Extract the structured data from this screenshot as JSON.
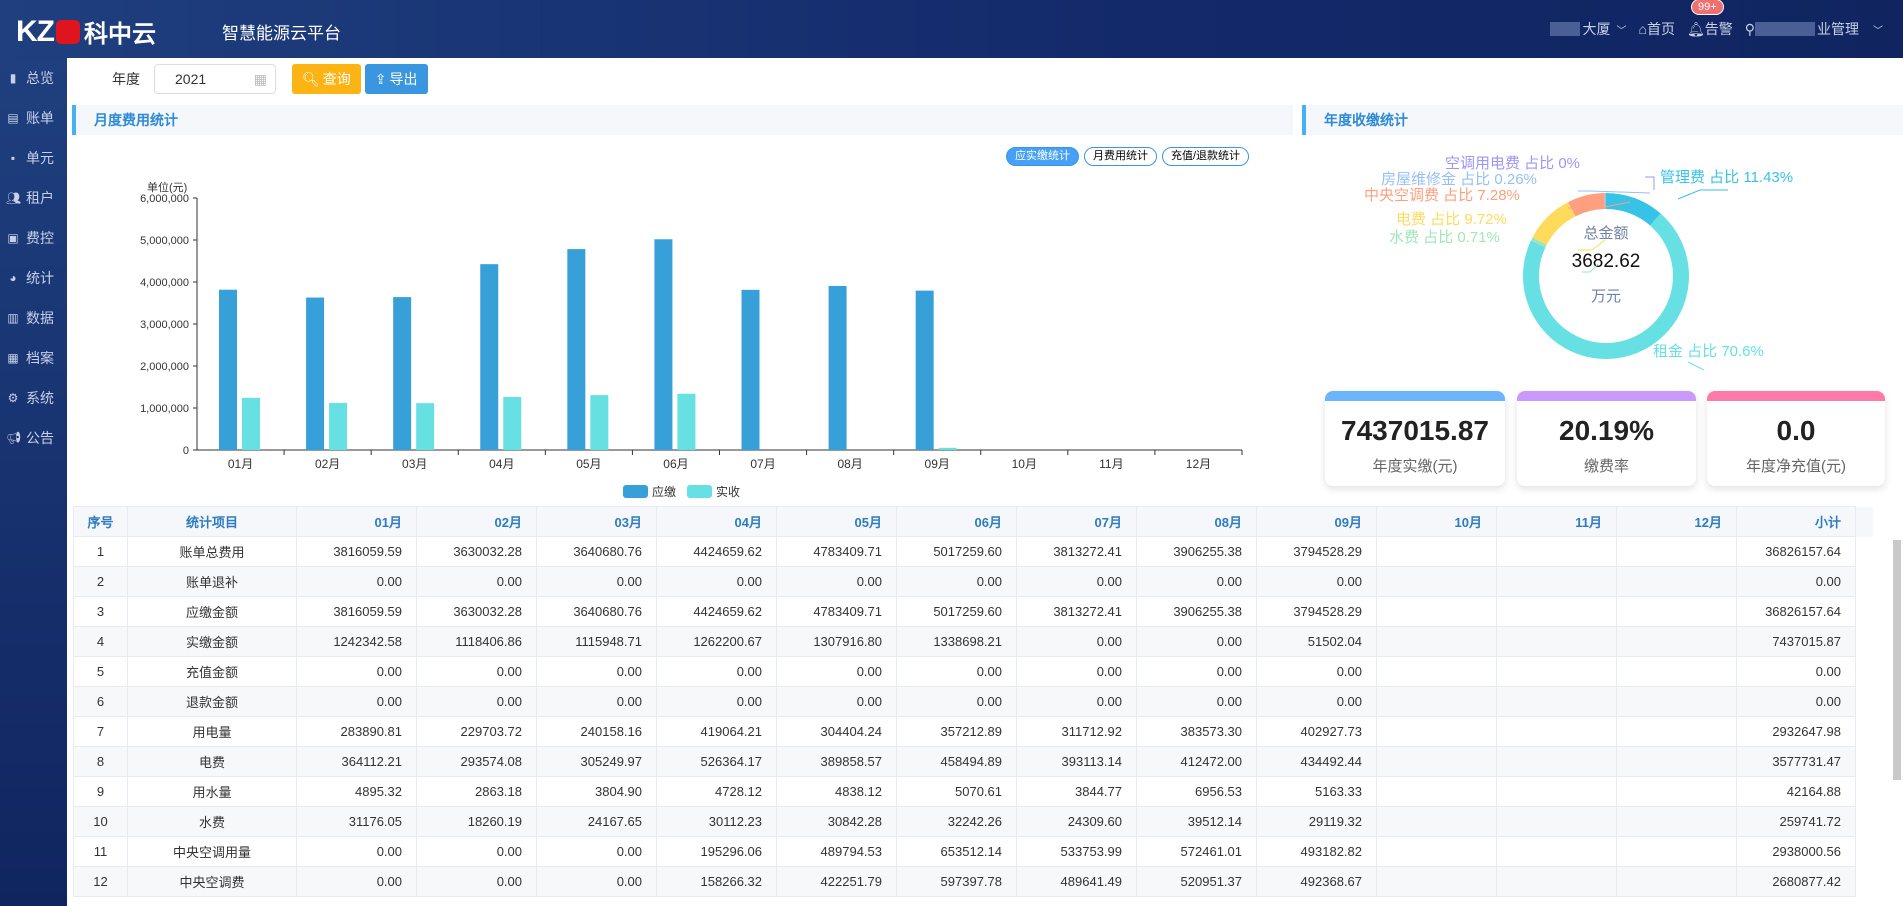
{
  "header": {
    "logo_text": "KZC",
    "logo_cn": "科中云",
    "subtitle": "智慧能源云平台",
    "building": "大厦",
    "home": "首页",
    "alarm": "告警",
    "alarm_badge": "99+",
    "user": "业管理"
  },
  "sidebar": {
    "items": [
      {
        "label": "总览",
        "icon": "bar-chart-icon"
      },
      {
        "label": "账单",
        "icon": "document-icon"
      },
      {
        "label": "单元",
        "icon": "grid-icon"
      },
      {
        "label": "租户",
        "icon": "users-icon"
      },
      {
        "label": "费控",
        "icon": "control-icon"
      },
      {
        "label": "统计",
        "icon": "pie-icon"
      },
      {
        "label": "数据",
        "icon": "data-icon"
      },
      {
        "label": "档案",
        "icon": "archive-icon"
      },
      {
        "label": "系统",
        "icon": "gear-icon"
      },
      {
        "label": "公告",
        "icon": "megaphone-icon"
      }
    ]
  },
  "toolbar": {
    "year_label": "年度",
    "year_value": "2021",
    "query": "查询",
    "export": "导出"
  },
  "sections": {
    "monthly": "月度费用统计",
    "annual": "年度收缴统计"
  },
  "toggles": [
    "应实缴统计",
    "月费用统计",
    "充值/退款统计"
  ],
  "chart_data": {
    "type": "bar",
    "ylabel": "单位(元)",
    "ylim": [
      0,
      6000000
    ],
    "yticks": [
      "0",
      "1,000,000",
      "2,000,000",
      "3,000,000",
      "4,000,000",
      "5,000,000",
      "6,000,000"
    ],
    "categories": [
      "01月",
      "02月",
      "03月",
      "04月",
      "05月",
      "06月",
      "07月",
      "08月",
      "09月",
      "10月",
      "11月",
      "12月"
    ],
    "series": [
      {
        "name": "应缴",
        "color": "#38a0d8",
        "values": [
          3816059.59,
          3630032.28,
          3640680.76,
          4424659.62,
          4783409.71,
          5017259.6,
          3813272.41,
          3906255.38,
          3794528.29,
          null,
          null,
          null
        ]
      },
      {
        "name": "实收",
        "color": "#67e0e3",
        "values": [
          1242342.58,
          1118406.86,
          1115948.71,
          1262200.67,
          1307916.8,
          1338698.21,
          0,
          0,
          51502.04,
          null,
          null,
          null
        ]
      }
    ],
    "legend": "bottom"
  },
  "donut": {
    "title": "总金额",
    "value": "3682.62",
    "unit": "万元",
    "slices": [
      {
        "label": "管理费 占比 11.43%",
        "pct": 11.43,
        "color": "#37c2e8"
      },
      {
        "label": "租金 占比 70.6%",
        "pct": 70.6,
        "color": "#67e0e3"
      },
      {
        "label": "水费 占比 0.71%",
        "pct": 0.71,
        "color": "#9fe6b8"
      },
      {
        "label": "电费 占比 9.72%",
        "pct": 9.72,
        "color": "#ffdb5c"
      },
      {
        "label": "中央空调费 占比 7.28%",
        "pct": 7.28,
        "color": "#ff9f7f"
      },
      {
        "label": "房屋维修金 占比 0.26%",
        "pct": 0.26,
        "color": "#96bff7"
      },
      {
        "label": "空调用电费 占比 0%",
        "pct": 0,
        "color": "#9d96f5"
      }
    ]
  },
  "kpis": [
    {
      "value": "7437015.87",
      "label": "年度实缴(元)",
      "color": "#6cb4fb"
    },
    {
      "value": "20.19%",
      "label": "缴费率",
      "color": "#c99afb"
    },
    {
      "value": "0.0",
      "label": "年度净充值(元)",
      "color": "#fe7aa8"
    }
  ],
  "table": {
    "headers": [
      "序号",
      "统计项目",
      "01月",
      "02月",
      "03月",
      "04月",
      "05月",
      "06月",
      "07月",
      "08月",
      "09月",
      "10月",
      "11月",
      "12月",
      "小计"
    ],
    "rows": [
      [
        "1",
        "账单总费用",
        "3816059.59",
        "3630032.28",
        "3640680.76",
        "4424659.62",
        "4783409.71",
        "5017259.60",
        "3813272.41",
        "3906255.38",
        "3794528.29",
        "",
        "",
        "",
        "36826157.64"
      ],
      [
        "2",
        "账单退补",
        "0.00",
        "0.00",
        "0.00",
        "0.00",
        "0.00",
        "0.00",
        "0.00",
        "0.00",
        "0.00",
        "",
        "",
        "",
        "0.00"
      ],
      [
        "3",
        "应缴金额",
        "3816059.59",
        "3630032.28",
        "3640680.76",
        "4424659.62",
        "4783409.71",
        "5017259.60",
        "3813272.41",
        "3906255.38",
        "3794528.29",
        "",
        "",
        "",
        "36826157.64"
      ],
      [
        "4",
        "实缴金额",
        "1242342.58",
        "1118406.86",
        "1115948.71",
        "1262200.67",
        "1307916.80",
        "1338698.21",
        "0.00",
        "0.00",
        "51502.04",
        "",
        "",
        "",
        "7437015.87"
      ],
      [
        "5",
        "充值金额",
        "0.00",
        "0.00",
        "0.00",
        "0.00",
        "0.00",
        "0.00",
        "0.00",
        "0.00",
        "0.00",
        "",
        "",
        "",
        "0.00"
      ],
      [
        "6",
        "退款金额",
        "0.00",
        "0.00",
        "0.00",
        "0.00",
        "0.00",
        "0.00",
        "0.00",
        "0.00",
        "0.00",
        "",
        "",
        "",
        "0.00"
      ],
      [
        "7",
        "用电量",
        "283890.81",
        "229703.72",
        "240158.16",
        "419064.21",
        "304404.24",
        "357212.89",
        "311712.92",
        "383573.30",
        "402927.73",
        "",
        "",
        "",
        "2932647.98"
      ],
      [
        "8",
        "电费",
        "364112.21",
        "293574.08",
        "305249.97",
        "526364.17",
        "389858.57",
        "458494.89",
        "393113.14",
        "412472.00",
        "434492.44",
        "",
        "",
        "",
        "3577731.47"
      ],
      [
        "9",
        "用水量",
        "4895.32",
        "2863.18",
        "3804.90",
        "4728.12",
        "4838.12",
        "5070.61",
        "3844.77",
        "6956.53",
        "5163.33",
        "",
        "",
        "",
        "42164.88"
      ],
      [
        "10",
        "水费",
        "31176.05",
        "18260.19",
        "24167.65",
        "30112.23",
        "30842.28",
        "32242.26",
        "24309.60",
        "39512.14",
        "29119.32",
        "",
        "",
        "",
        "259741.72"
      ],
      [
        "11",
        "中央空调用量",
        "0.00",
        "0.00",
        "0.00",
        "195296.06",
        "489794.53",
        "653512.14",
        "533753.99",
        "572461.01",
        "493182.82",
        "",
        "",
        "",
        "2938000.56"
      ],
      [
        "12",
        "中央空调费",
        "0.00",
        "0.00",
        "0.00",
        "158266.32",
        "422251.79",
        "597397.78",
        "489641.49",
        "520951.37",
        "492368.67",
        "",
        "",
        "",
        "2680877.42"
      ]
    ]
  }
}
